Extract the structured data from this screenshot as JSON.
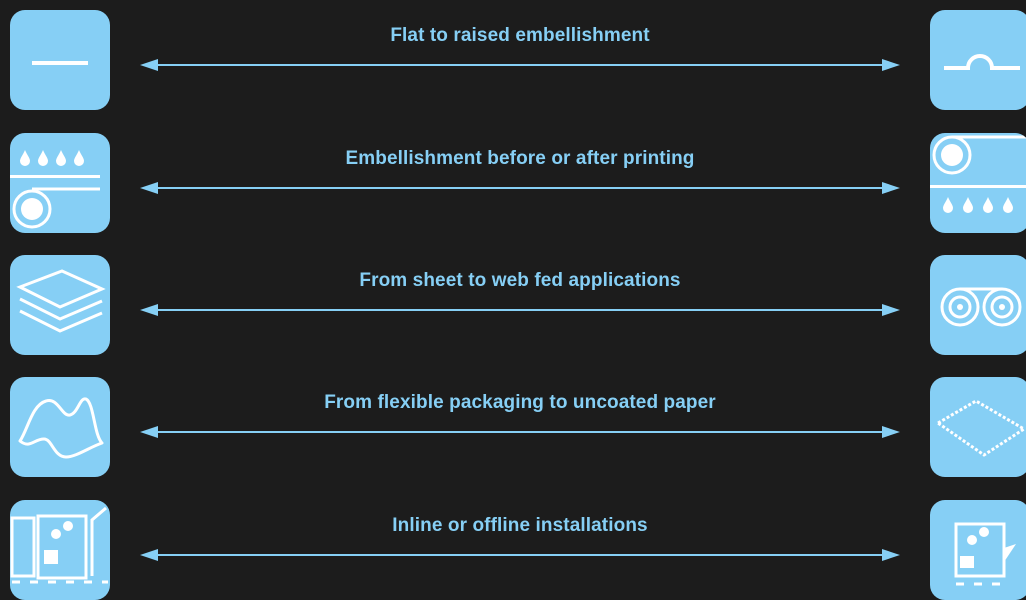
{
  "colors": {
    "background": "#1c1c1c",
    "accent": "#86cff5",
    "icon": "#ffffff"
  },
  "rows": [
    {
      "label": "Flat to raised embellishment",
      "left_icon": "flat-line-icon",
      "right_icon": "raised-bump-icon"
    },
    {
      "label": "Embellishment before or after printing",
      "left_icon": "drops-above-roller-icon",
      "right_icon": "roller-above-drops-icon"
    },
    {
      "label": "From sheet to web fed applications",
      "left_icon": "stacked-sheets-icon",
      "right_icon": "web-rolls-icon"
    },
    {
      "label": "From flexible packaging to uncoated paper",
      "left_icon": "flexible-packaging-icon",
      "right_icon": "uncoated-paper-icon"
    },
    {
      "label": "Inline or offline installations",
      "left_icon": "inline-machine-icon",
      "right_icon": "offline-machine-icon"
    }
  ]
}
